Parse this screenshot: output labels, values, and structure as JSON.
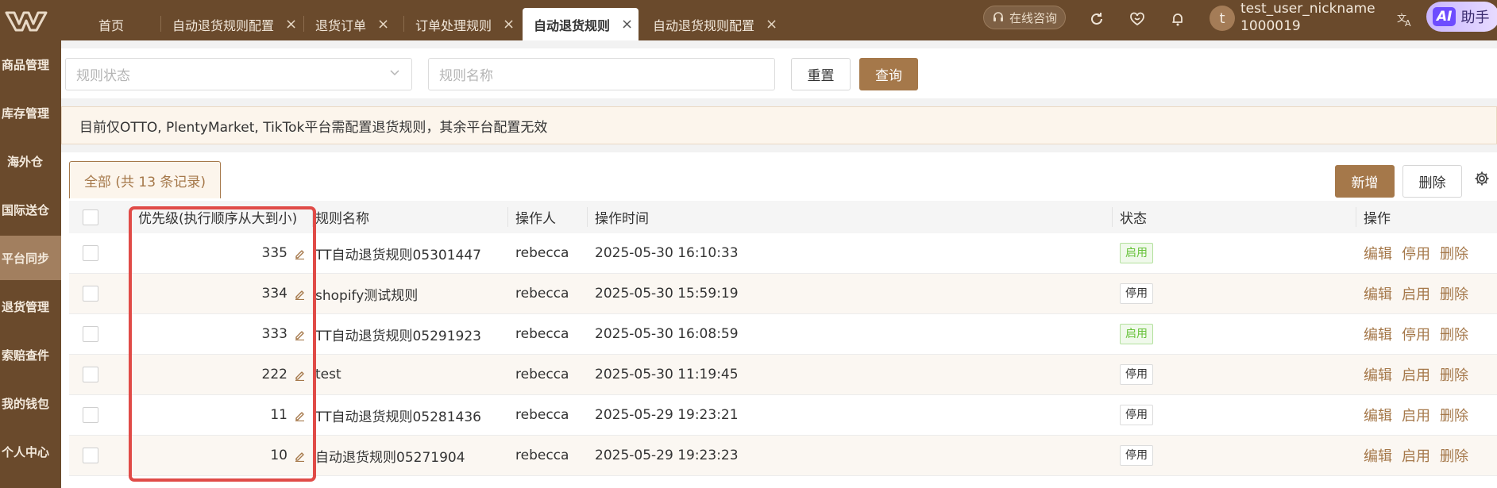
{
  "app": {
    "consult_label": "在线咨询",
    "user_name": "test_user_nickname",
    "user_id": "1000019",
    "avatar_letter": "t",
    "ai_badge": "AI",
    "ai_label": "助手"
  },
  "tabs": [
    {
      "label": "首页",
      "closable": false,
      "active": false
    },
    {
      "label": "自动退货规则配置",
      "closable": true,
      "active": false
    },
    {
      "label": "退货订单",
      "closable": true,
      "active": false
    },
    {
      "label": "订单处理规则",
      "closable": true,
      "active": false
    },
    {
      "label": "自动退货规则",
      "closable": true,
      "active": true
    },
    {
      "label": "自动退货规则配置",
      "closable": true,
      "active": false
    }
  ],
  "sidebar": {
    "items": [
      {
        "label": "商品管理"
      },
      {
        "label": "库存管理"
      },
      {
        "label": "海外仓"
      },
      {
        "label": "国际送仓"
      },
      {
        "label": "平台同步",
        "active": true
      },
      {
        "label": "退货管理"
      },
      {
        "label": "索赔查件"
      },
      {
        "label": "我的钱包"
      },
      {
        "label": "个人中心"
      }
    ]
  },
  "filters": {
    "status_placeholder": "规则状态",
    "name_placeholder": "规则名称",
    "reset_label": "重置",
    "query_label": "查询"
  },
  "notice": "目前仅OTTO, PlentyMarket, TikTok平台需配置退货规则，其余平台配置无效",
  "toolbar": {
    "tab_all_label": "全部 (共 13 条记录)",
    "add_label": "新增",
    "delete_label": "删除"
  },
  "table": {
    "headers": {
      "priority": "优先级(执行顺序从大到小)",
      "name": "规则名称",
      "operator": "操作人",
      "time": "操作时间",
      "status": "状态",
      "actions": "操作"
    },
    "rows": [
      {
        "priority": "335",
        "name": "TT自动退货规则05301447",
        "operator": "rebecca",
        "time": "2025-05-30 16:10:33",
        "status": "启用",
        "status_on": true,
        "action_edit": "编辑",
        "action_toggle": "停用",
        "action_delete": "删除"
      },
      {
        "priority": "334",
        "name": "shopify测试规则",
        "operator": "rebecca",
        "time": "2025-05-30 15:59:19",
        "status": "停用",
        "status_on": false,
        "action_edit": "编辑",
        "action_toggle": "启用",
        "action_delete": "删除"
      },
      {
        "priority": "333",
        "name": "TT自动退货规则05291923",
        "operator": "rebecca",
        "time": "2025-05-30 16:08:59",
        "status": "启用",
        "status_on": true,
        "action_edit": "编辑",
        "action_toggle": "停用",
        "action_delete": "删除"
      },
      {
        "priority": "222",
        "name": "test",
        "operator": "rebecca",
        "time": "2025-05-30 11:19:45",
        "status": "停用",
        "status_on": false,
        "action_edit": "编辑",
        "action_toggle": "启用",
        "action_delete": "删除"
      },
      {
        "priority": "11",
        "name": "TT自动退货规则05281436",
        "operator": "rebecca",
        "time": "2025-05-29 19:23:21",
        "status": "停用",
        "status_on": false,
        "action_edit": "编辑",
        "action_toggle": "启用",
        "action_delete": "删除"
      },
      {
        "priority": "10",
        "name": "自动退货规则05271904",
        "operator": "rebecca",
        "time": "2025-05-29 19:23:23",
        "status": "停用",
        "status_on": false,
        "action_edit": "编辑",
        "action_toggle": "启用",
        "action_delete": "删除"
      }
    ]
  },
  "colors": {
    "brand": "#6a4a2c",
    "accent": "#a5784a",
    "highlight": "#e04b47",
    "enabled": "#67c23a"
  }
}
